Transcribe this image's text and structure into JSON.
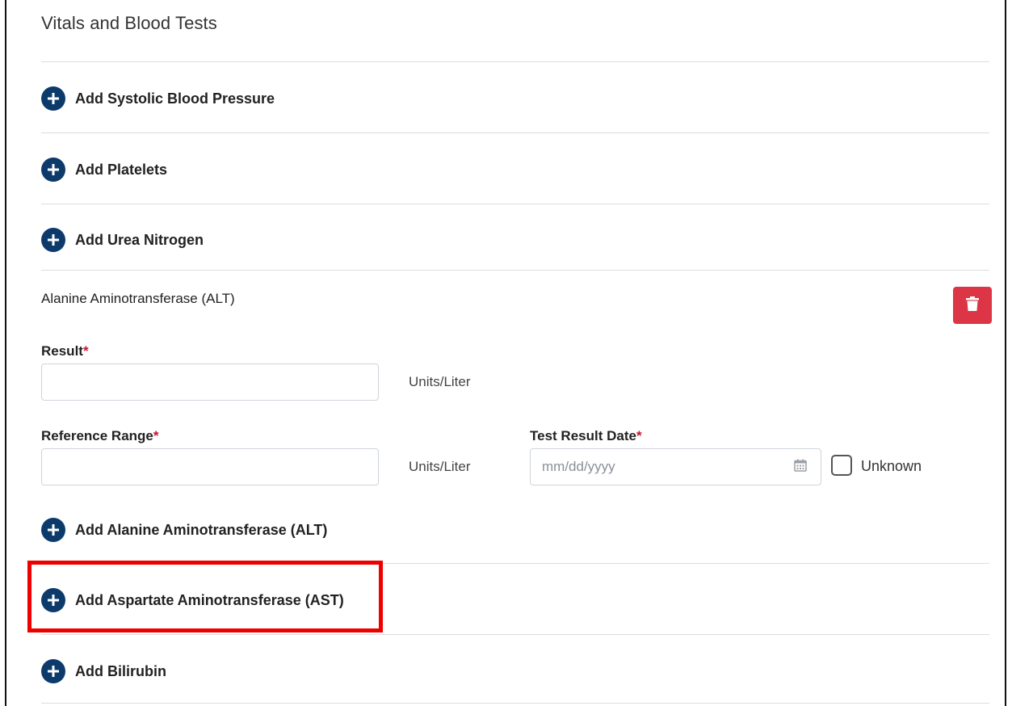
{
  "section": {
    "title": "Vitals and Blood Tests"
  },
  "add_items": {
    "systolic": "Add Systolic Blood Pressure",
    "platelets": "Add Platelets",
    "urea": "Add Urea Nitrogen",
    "alt": "Add Alanine Aminotransferase (ALT)",
    "ast": "Add Aspartate Aminotransferase (AST)",
    "bilirubin": "Add Bilirubin"
  },
  "alt_panel": {
    "title": "Alanine Aminotransferase (ALT)",
    "result_label": "Result",
    "result_value": "",
    "result_units": "Units/Liter",
    "reference_label": "Reference Range",
    "reference_value": "",
    "reference_units": "Units/Liter",
    "date_label": "Test Result Date",
    "date_placeholder": "mm/dd/yyyy",
    "unknown_label": "Unknown",
    "unknown_checked": false,
    "required_marker": "*"
  },
  "icons": {
    "add": "plus-circle-icon",
    "delete": "trash-icon",
    "date": "calendar-icon"
  },
  "colors": {
    "icon_navy": "#0c3b6b",
    "delete_red": "#dc3545",
    "required_red": "#c8102e",
    "highlight_red": "#ee0000"
  }
}
